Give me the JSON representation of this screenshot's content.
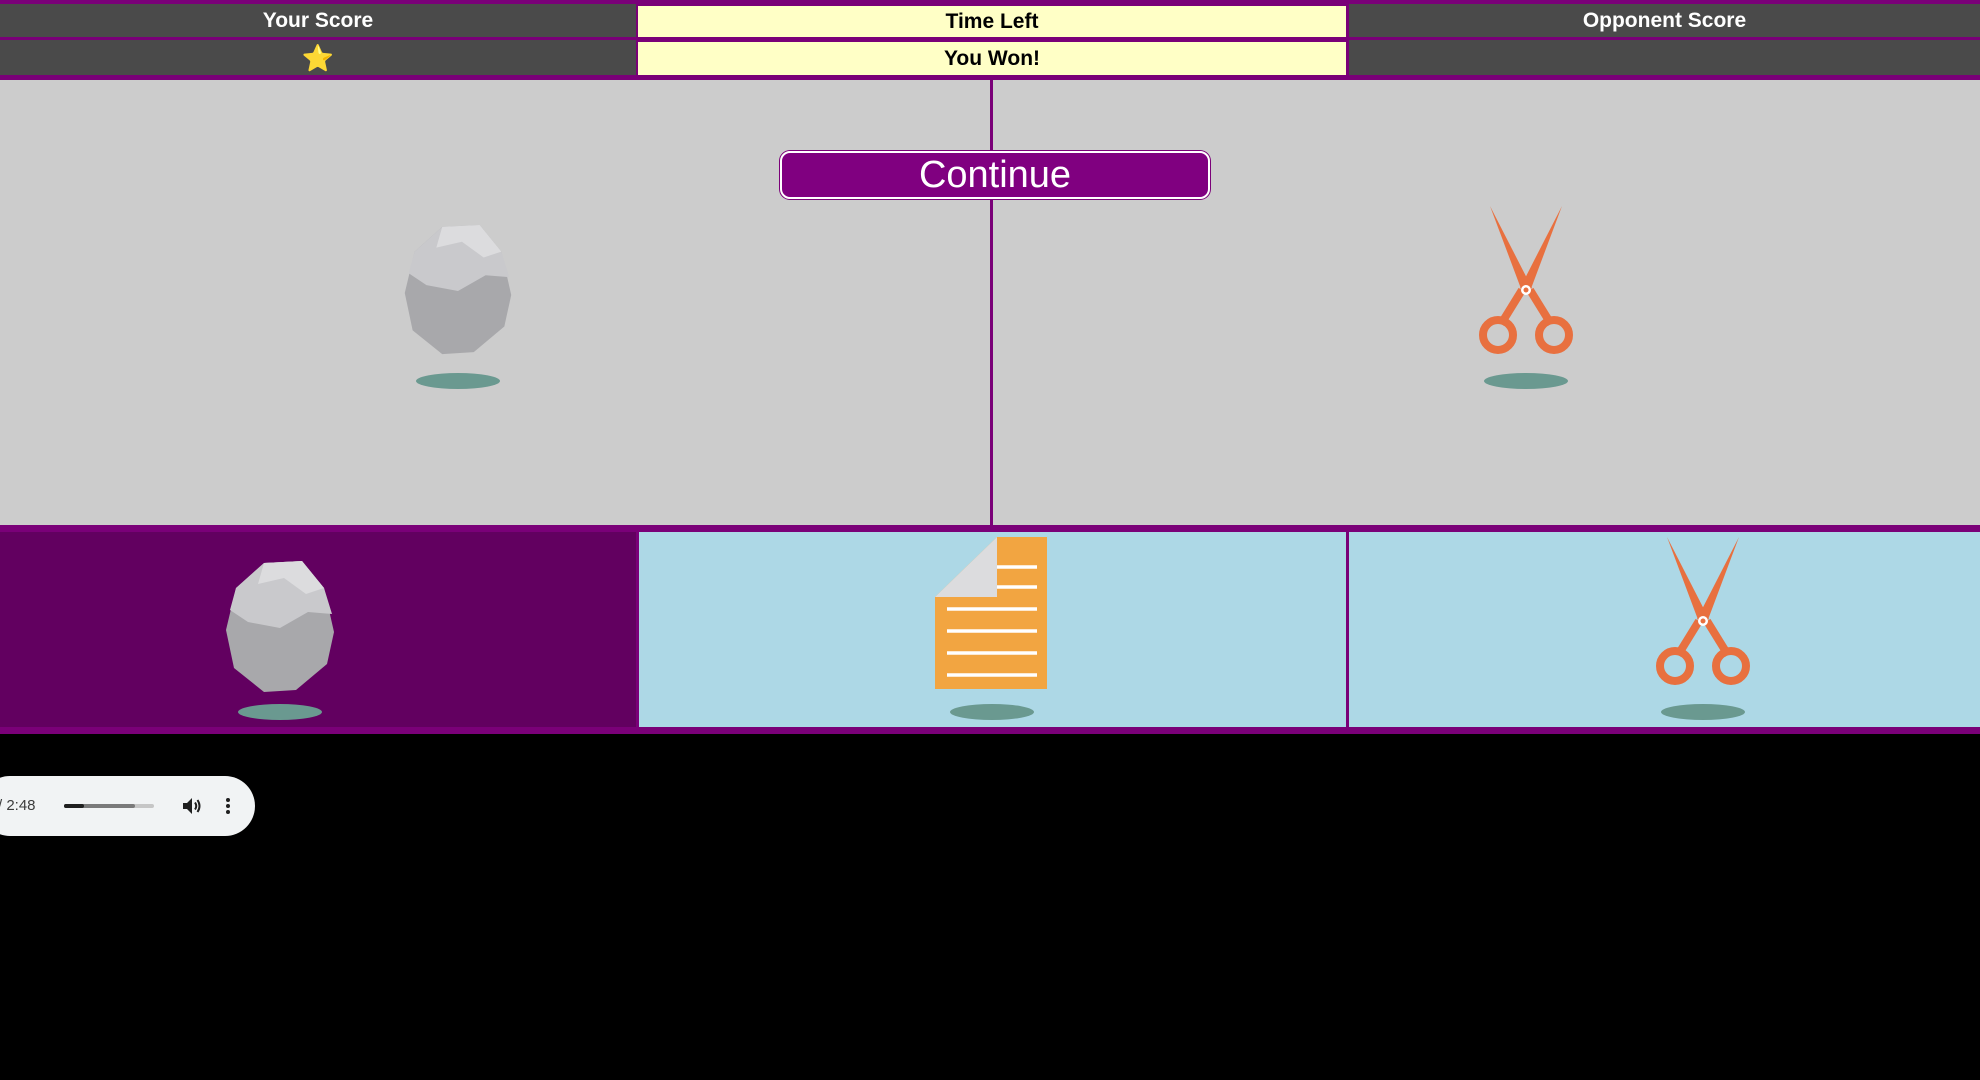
{
  "scoreboard": {
    "your_score_label": "Your Score",
    "time_left_label": "Time Left",
    "opponent_score_label": "Opponent Score",
    "your_score_value": "⭐",
    "status": "You Won!",
    "opponent_score_value": ""
  },
  "arena": {
    "continue_label": "Continue",
    "player_choice_icon": "rock-icon",
    "opponent_choice_icon": "scissors-icon"
  },
  "choices": [
    {
      "icon": "rock-icon",
      "selected": true
    },
    {
      "icon": "paper-icon",
      "selected": false
    },
    {
      "icon": "scissors-icon",
      "selected": false
    }
  ],
  "audio": {
    "time": "/ 2:48",
    "played_fraction": 0.22,
    "buffered_fraction": 0.79
  },
  "colors": {
    "border_purple": "#7a0078",
    "button_purple": "#800080",
    "selected_choice": "#620060",
    "choice_bg": "#add8e6",
    "arena_bg": "#cccccc",
    "status_bg": "#ffffc6",
    "score_bg": "#4a4a4a",
    "scissors": "#e8703f",
    "paper": "#f2a541"
  }
}
